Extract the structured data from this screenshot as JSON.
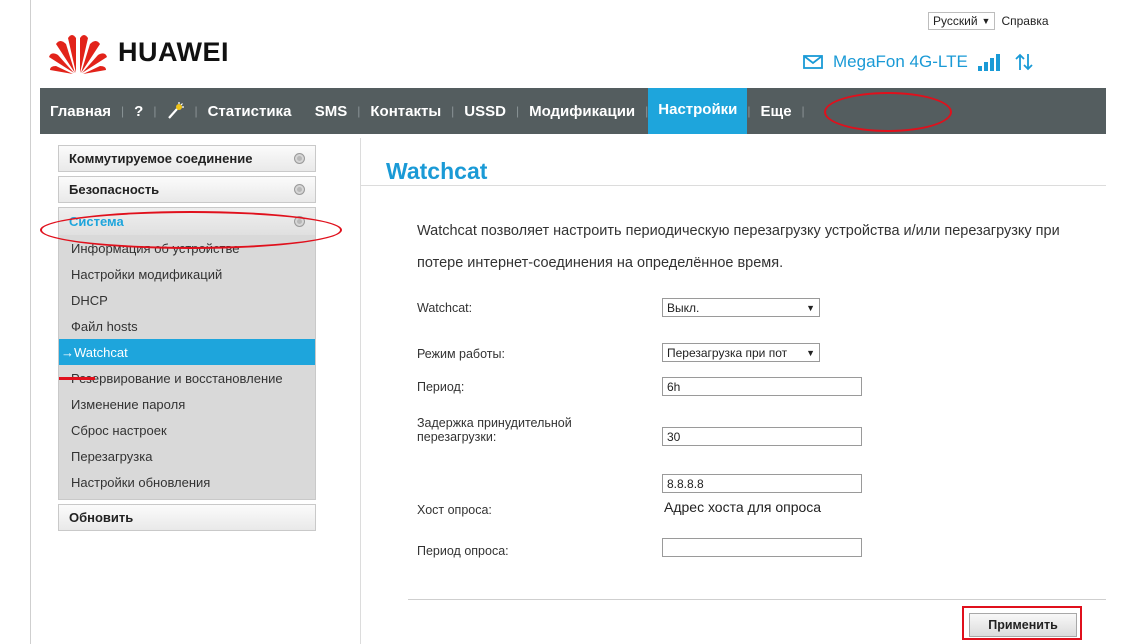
{
  "header": {
    "language": "Русский",
    "help": "Справка",
    "brand": "HUAWEI",
    "operator": "MegaFon 4G-LTE"
  },
  "nav": {
    "items": [
      "Главная",
      "?",
      "Статистика",
      "SMS",
      "Контакты",
      "USSD",
      "Модификации",
      "Настройки",
      "Еще"
    ],
    "active": "Настройки"
  },
  "sidebar": {
    "dialup": "Коммутируемое соединение",
    "security": "Безопасность",
    "system": "Система",
    "system_items": [
      "Информация об устройстве",
      "Настройки модификаций",
      "DHCP",
      "Файл hosts",
      "→Watchcat",
      "Резервирование и восстановление",
      "Изменение пароля",
      "Сброс настроек",
      "Перезагрузка",
      "Настройки обновления"
    ],
    "update": "Обновить"
  },
  "page": {
    "title": "Watchcat",
    "description": "Watchcat позволяет настроить периодическую перезагрузку устройства и/или перезагрузку при потере интернет-соединения на определённое время."
  },
  "form": {
    "watchcat_label": "Watchcat:",
    "watchcat_value": "Выкл.",
    "mode_label": "Режим работы:",
    "mode_value": "Перезагрузка при пот",
    "period_label": "Период:",
    "period_value": "6h",
    "delay_label": "Задержка принудительной перезагрузки:",
    "delay_value": "30",
    "host_label": "Хост опроса:",
    "host_value": "8.8.8.8",
    "host_hint": "Адрес хоста для опроса",
    "poll_label": "Период опроса:",
    "poll_value": ""
  },
  "actions": {
    "apply": "Применить"
  },
  "colors": {
    "accent": "#1ea5dc",
    "navbar": "#545d5f",
    "highlight": "#e0101c"
  }
}
